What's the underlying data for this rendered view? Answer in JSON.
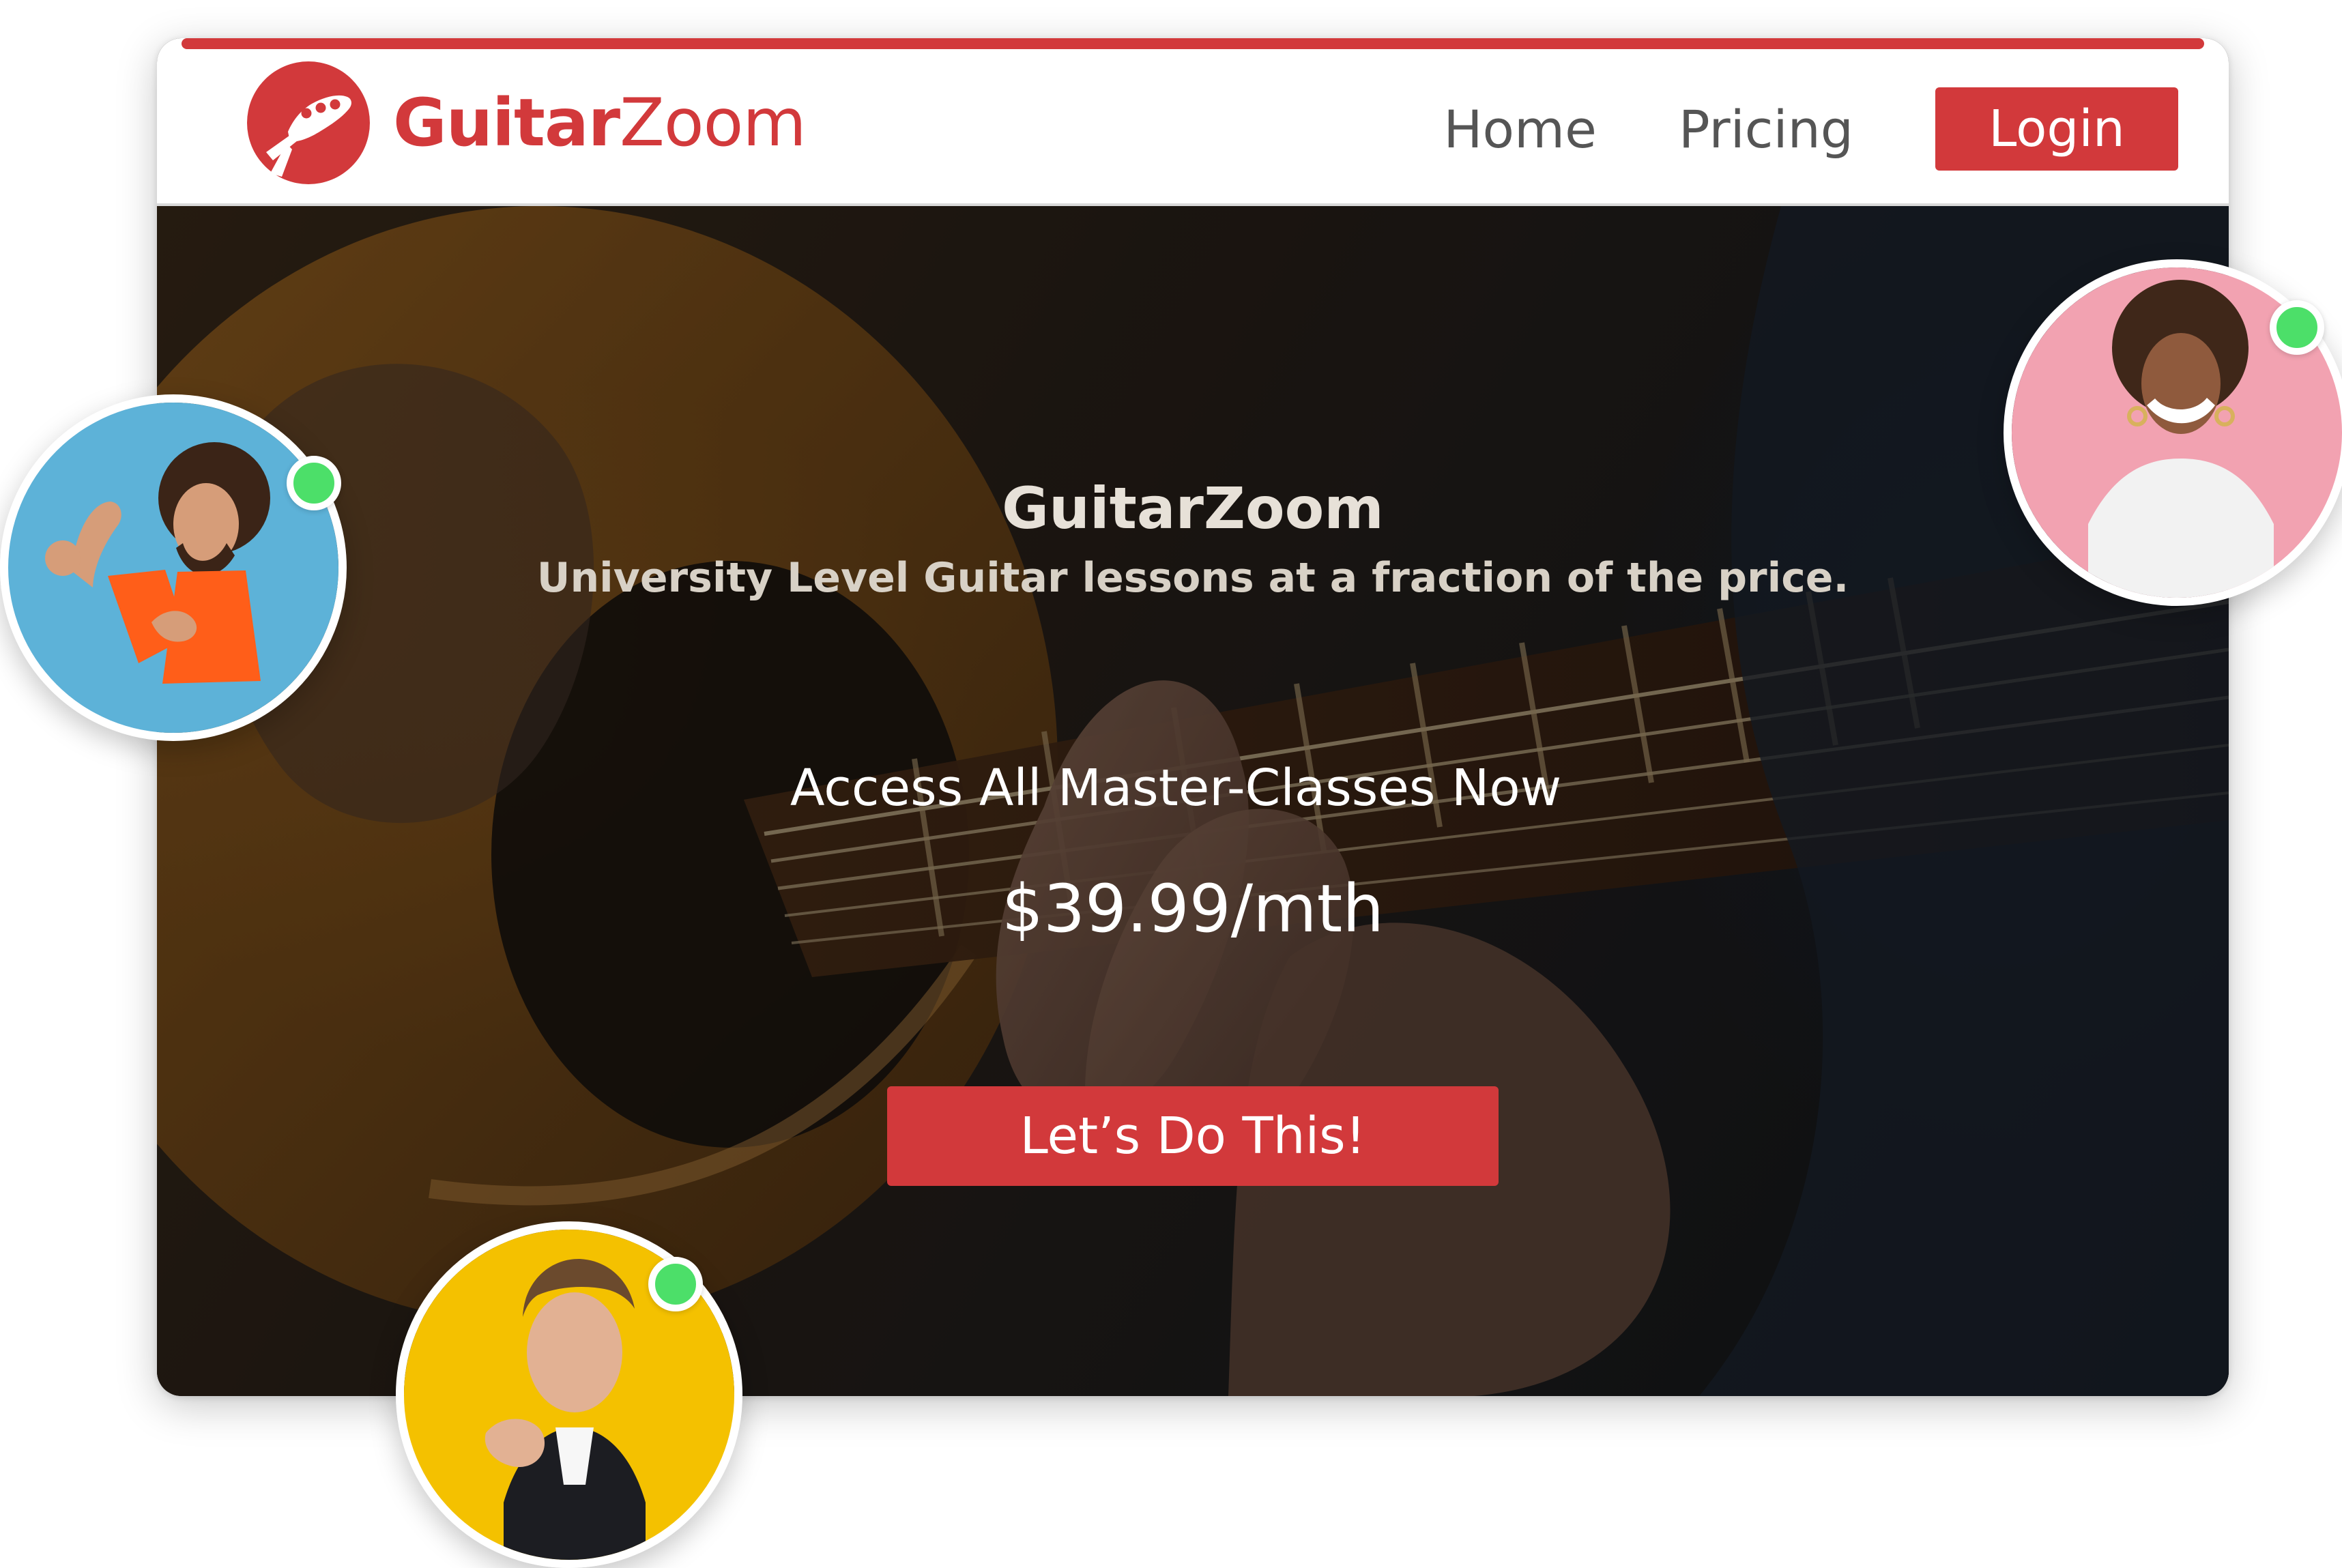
{
  "header": {
    "logo": {
      "strong": "Guitar",
      "light": "Zoom",
      "icon": "guitar-headstock-icon"
    },
    "nav": {
      "home": "Home",
      "pricing": "Pricing",
      "login": "Login"
    }
  },
  "hero": {
    "title": "GuitarZoom",
    "subtitle": "University Level Guitar lessons at a fraction of the price.",
    "offer": "Access All Master-Classes Now",
    "price": "$39.99/mth",
    "cta": "Let’s Do This!"
  },
  "avatars": [
    {
      "name": "avatar-left",
      "status": "online"
    },
    {
      "name": "avatar-right",
      "status": "online"
    },
    {
      "name": "avatar-bottom",
      "status": "online"
    }
  ],
  "colors": {
    "brand_red": "#d2393b",
    "status_green": "#4cdf69"
  }
}
